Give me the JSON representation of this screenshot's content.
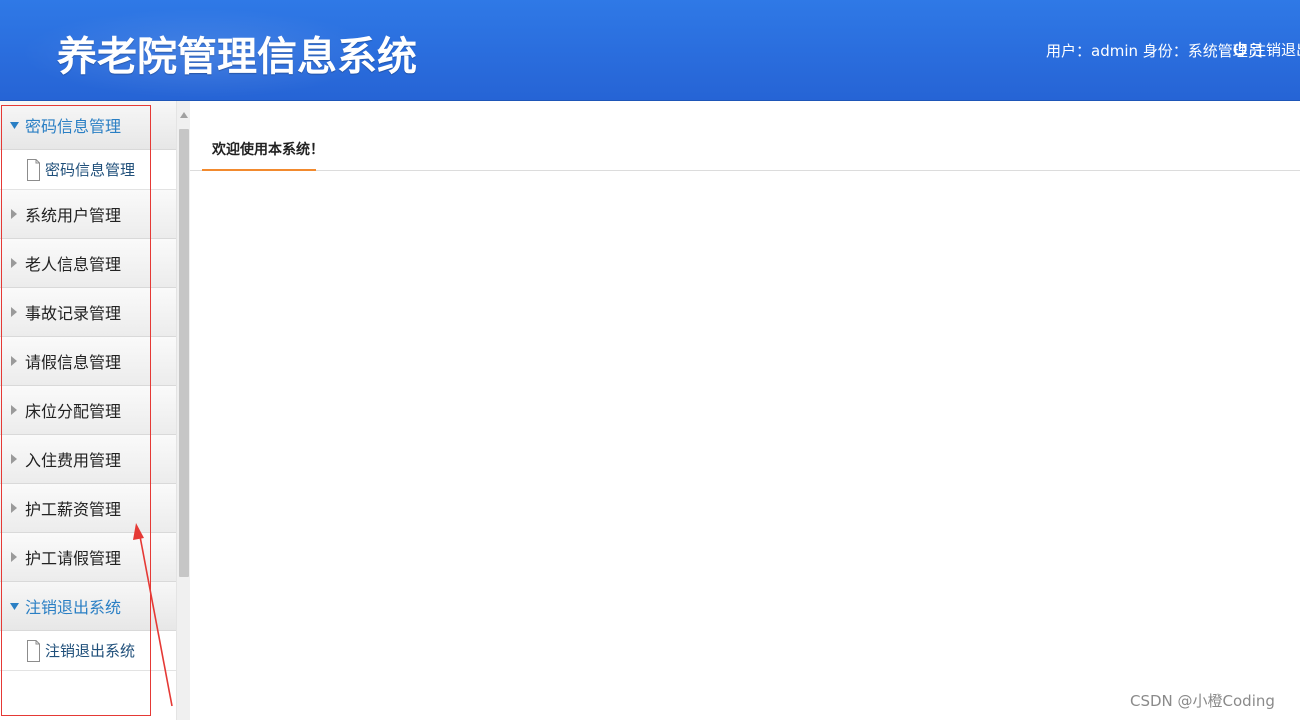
{
  "header": {
    "title": "养老院管理信息系统",
    "user_info": "用户：admin 身份：系统管理员",
    "logout_label": "注销退出",
    "logout_icon": "power-icon"
  },
  "sidebar": {
    "groups": [
      {
        "label": "密码信息管理",
        "expanded": true,
        "items": [
          {
            "label": "密码信息管理",
            "icon": "document-icon"
          }
        ]
      },
      {
        "label": "系统用户管理",
        "expanded": false,
        "items": []
      },
      {
        "label": "老人信息管理",
        "expanded": false,
        "items": []
      },
      {
        "label": "事故记录管理",
        "expanded": false,
        "items": []
      },
      {
        "label": "请假信息管理",
        "expanded": false,
        "items": []
      },
      {
        "label": "床位分配管理",
        "expanded": false,
        "items": []
      },
      {
        "label": "入住费用管理",
        "expanded": false,
        "items": []
      },
      {
        "label": "护工薪资管理",
        "expanded": false,
        "items": []
      },
      {
        "label": "护工请假管理",
        "expanded": false,
        "items": []
      },
      {
        "label": "注销退出系统",
        "expanded": true,
        "items": [
          {
            "label": "注销退出系统",
            "icon": "document-icon"
          }
        ]
      }
    ]
  },
  "main": {
    "tabs": [
      {
        "label": "欢迎使用本系统！",
        "active": true
      }
    ]
  },
  "watermark": "CSDN @小橙Coding",
  "colors": {
    "header_blue": "#2a6ddd",
    "active_group_text": "#2a7fc4",
    "tab_underline": "#f28a2e",
    "annotation_red": "#e53935"
  }
}
